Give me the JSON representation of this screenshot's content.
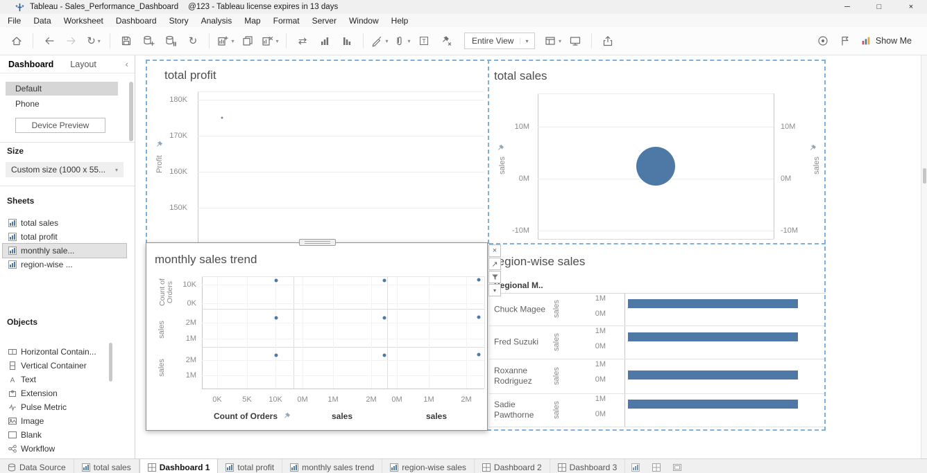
{
  "colors": {
    "accent": "#4e79a7",
    "selection_dash": "#7fb0dd"
  },
  "titlebar": {
    "app_title": "Tableau - Sales_Performance_Dashboard",
    "license_note": "@123 - Tableau license expires in 13 days"
  },
  "icons": {
    "minimize": "─",
    "restore": "□",
    "close": "×",
    "caret_down": "▾",
    "collapse_left": "‹",
    "replay": "↻",
    "run_updates": "↻",
    "swap": "⇄",
    "go_to_sheet": "↗",
    "panel_close": "×"
  },
  "menu": {
    "items": [
      "File",
      "Data",
      "Worksheet",
      "Dashboard",
      "Story",
      "Analysis",
      "Map",
      "Format",
      "Server",
      "Window",
      "Help"
    ]
  },
  "toolbar": {
    "fit_value": "Entire View",
    "show_me_label": "Show Me"
  },
  "sidebar": {
    "tabs": {
      "dashboard": "Dashboard",
      "layout": "Layout"
    },
    "devices": [
      "Default",
      "Phone"
    ],
    "device_preview": "Device Preview",
    "size": {
      "label": "Size",
      "value": "Custom size (1000 x 55..."
    },
    "sheets": {
      "label": "Sheets",
      "items": [
        "total sales",
        "total profit",
        "monthly sale...",
        "region-wise ..."
      ]
    },
    "objects": {
      "label": "Objects",
      "items": [
        "Horizontal Contain...",
        "Vertical Container",
        "Text",
        "Extension",
        "Pulse Metric",
        "Image",
        "Blank",
        "Workflow"
      ]
    }
  },
  "charts": {
    "total_profit": {
      "title": "total profit",
      "axis_label": "Profit",
      "yticks": [
        "180K",
        "170K",
        "160K",
        "150K"
      ]
    },
    "total_sales": {
      "title": "total sales",
      "axis_label_left": "sales",
      "axis_label_right": "sales",
      "yticks": [
        "10M",
        "0M",
        "-10M"
      ]
    },
    "monthly": {
      "title": "monthly sales trend",
      "row_axes": [
        {
          "label": "Count of Orders",
          "ticks": [
            "10K",
            "0K"
          ]
        },
        {
          "label": "sales",
          "ticks": [
            "2M",
            "1M"
          ]
        },
        {
          "label": "sales",
          "ticks": [
            "2M",
            "1M"
          ]
        }
      ],
      "col_axes": [
        {
          "label": "Count of Orders",
          "ticks": [
            "0K",
            "5K",
            "10K"
          ]
        },
        {
          "label": "sales",
          "ticks": [
            "0M",
            "1M",
            "2M"
          ]
        },
        {
          "label": "sales",
          "ticks": [
            "0M",
            "1M",
            "2M"
          ]
        }
      ]
    },
    "region": {
      "title": "region-wise sales",
      "col_header": "Regional M..",
      "axis_label": "sales",
      "tick_top": "1M",
      "tick_bottom": "0M",
      "managers": [
        "Chuck Magee",
        "Fred Suzuki",
        "Roxanne Rodriguez",
        "Sadie Pawthorne"
      ]
    }
  },
  "chart_data": [
    {
      "type": "scatter",
      "title": "total profit",
      "ylabel": "Profit",
      "ytick_labels": [
        "180K",
        "170K",
        "160K",
        "150K"
      ],
      "points": [
        {
          "profit": 175000
        }
      ],
      "grid": true
    },
    {
      "type": "scatter",
      "title": "total sales",
      "ylabel": "sales",
      "ytick_labels": [
        "10M",
        "0M",
        "-10M"
      ],
      "ylim": [
        -10000000,
        10000000
      ],
      "mark": "circle",
      "mark_color": "#4e79a7",
      "points": [
        {
          "sales": 2400000
        }
      ]
    },
    {
      "type": "scatter",
      "title": "monthly sales trend",
      "layout": "measure-matrix",
      "row_measures": [
        "Count of Orders",
        "sales",
        "sales"
      ],
      "col_measures": [
        "Count of Orders",
        "sales",
        "sales"
      ],
      "row_tick_labels": [
        [
          "10K",
          "0K"
        ],
        [
          "2M",
          "1M"
        ],
        [
          "2M",
          "1M"
        ]
      ],
      "col_tick_labels": [
        [
          "0K",
          "5K",
          "10K"
        ],
        [
          "0M",
          "1M",
          "2M"
        ],
        [
          "0M",
          "1M",
          "2M"
        ]
      ],
      "mark_color": "#4e79a7",
      "points": [
        {
          "count_of_orders": 10500,
          "sales": 2200000
        }
      ]
    },
    {
      "type": "bar",
      "title": "region-wise sales",
      "orientation": "horizontal",
      "categories": [
        "Chuck Magee",
        "Fred Suzuki",
        "Roxanne Rodriguez",
        "Sadie Pawthorne"
      ],
      "values": [
        1100000,
        1100000,
        1100000,
        1100000
      ],
      "value_axis": "sales",
      "tick_labels": [
        "1M",
        "0M"
      ],
      "bar_color": "#4e79a7"
    }
  ],
  "bottom_tabs": {
    "items": [
      "Data Source",
      "total sales",
      "Dashboard 1",
      "total profit",
      "monthly sales trend",
      "region-wise sales",
      "Dashboard 2",
      "Dashboard 3"
    ],
    "active": "Dashboard 1"
  }
}
